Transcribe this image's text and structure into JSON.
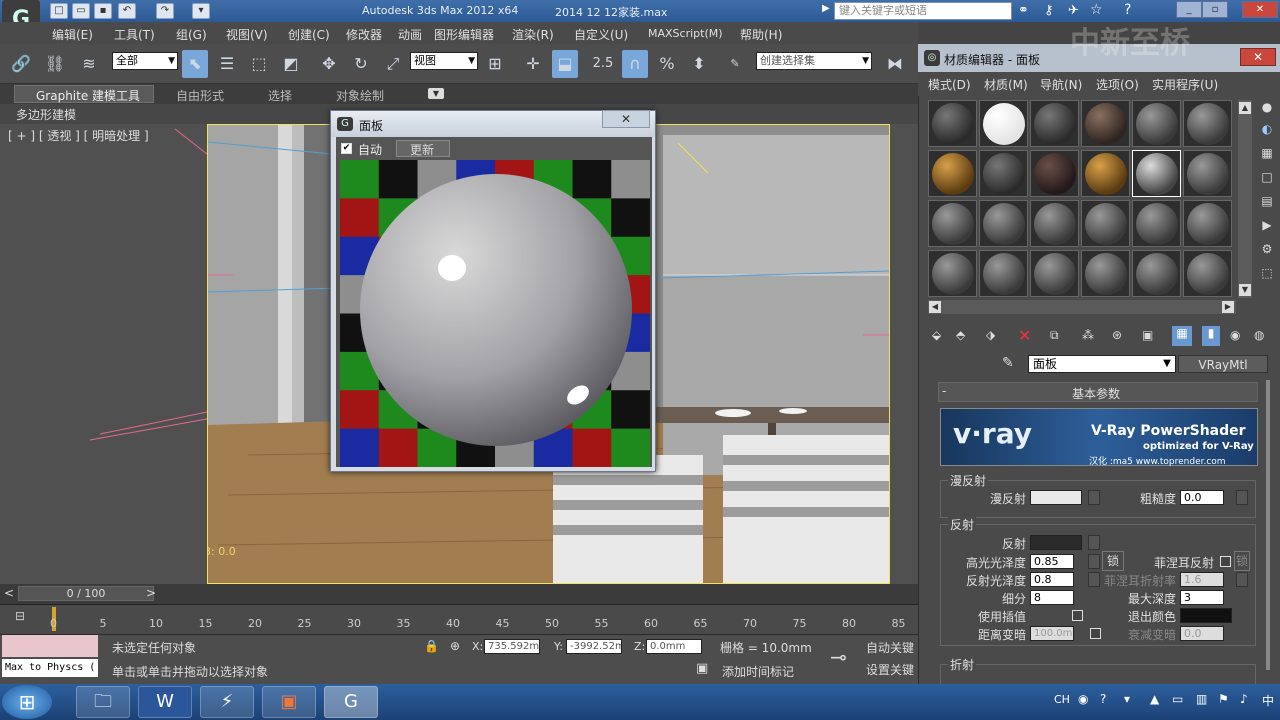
{
  "window": {
    "app_title": "Autodesk 3ds Max  2012 x64",
    "file_title": "2014 12 12家装.max",
    "search_placeholder": "键入关键字或短语"
  },
  "menubar": [
    "编辑(E)",
    "工具(T)",
    "组(G)",
    "视图(V)",
    "创建(C)",
    "修改器",
    "动画",
    "图形编辑器",
    "渲染(R)",
    "自定义(U)",
    "MAXScript(M)",
    "帮助(H)"
  ],
  "toolbar": {
    "filter_select": "全部",
    "ref_coord_select": "视图",
    "snap_value": "2.5",
    "named_selection": "创建选择集"
  },
  "ribbon": {
    "tabs": [
      "Graphite 建模工具",
      "自由形式",
      "选择",
      "对象绘制"
    ],
    "subtab": "多边形建模"
  },
  "viewport": {
    "label": "[ + ] [ 透视 ] [ 明暗处理 ]",
    "coord_text": "3: 0.0"
  },
  "panel_window": {
    "title": "面板",
    "auto_label": "自动",
    "update_label": "更新",
    "close_glyph": "✕",
    "checked": true
  },
  "material_editor": {
    "title": "材质编辑器 - 面板",
    "menus": [
      "模式(D)",
      "材质(M)",
      "导航(N)",
      "选项(O)",
      "实用程序(U)"
    ],
    "material_name": "面板",
    "material_type": "VRayMtl",
    "rollout_title": "基本参数",
    "banner": {
      "brand": "v·ray",
      "product": "V-Ray PowerShader",
      "sub": "optimized for V-Ray",
      "credit": "汉化 :ma5 www.toprender.com"
    },
    "diffuse": {
      "group": "漫反射",
      "label": "漫反射",
      "roughness_label": "粗糙度",
      "roughness": "0.0",
      "color": "#e8e8e8"
    },
    "reflection": {
      "group": "反射",
      "label": "反射",
      "color": "#2a2a2a",
      "hilight_gloss_label": "高光光泽度",
      "hilight_gloss": "0.85",
      "lock_label": "锁",
      "fresnel_label": "菲涅耳反射",
      "refl_gloss_label": "反射光泽度",
      "refl_gloss": "0.8",
      "fresnel_ior_label": "菲涅耳折射率",
      "fresnel_ior": "1.6",
      "subdivs_label": "细分",
      "subdivs": "8",
      "max_depth_label": "最大深度",
      "max_depth": "3",
      "use_interp_label": "使用插值",
      "exit_color_label": "退出颜色",
      "exit_color": "#111111",
      "dim_dist_label": "距离变暗",
      "dim_dist": "100.0m",
      "dim_falloff_label": "衰减变暗",
      "dim_falloff": "0.0"
    },
    "refraction_group": "折射"
  },
  "timeline": {
    "frame": "0 / 100",
    "ticks": [
      "0",
      "5",
      "10",
      "15",
      "20",
      "25",
      "30",
      "35",
      "40",
      "45",
      "50",
      "55",
      "60",
      "65",
      "70",
      "75",
      "80",
      "85"
    ]
  },
  "status": {
    "script_line": "Max to Physcs (",
    "selection_text": "未选定任何对象",
    "prompt_text": "单击或单击并拖动以选择对象",
    "x_label": "X:",
    "x": "735.592mm",
    "y_label": "Y:",
    "y": "-3992.52m",
    "z_label": "Z:",
    "z": "0.0mm",
    "grid": "栅格 = 10.0mm",
    "add_time_tag": "添加时间标记",
    "auto_key": "自动关键",
    "set_key": "设置关键"
  },
  "taskbar": {
    "tray_lang": "CH",
    "apps": [
      "explorer-icon",
      "word-icon",
      "thunder-icon",
      "powerpoint-icon",
      "3dsmax-icon"
    ]
  },
  "watermark": "中新至桥"
}
